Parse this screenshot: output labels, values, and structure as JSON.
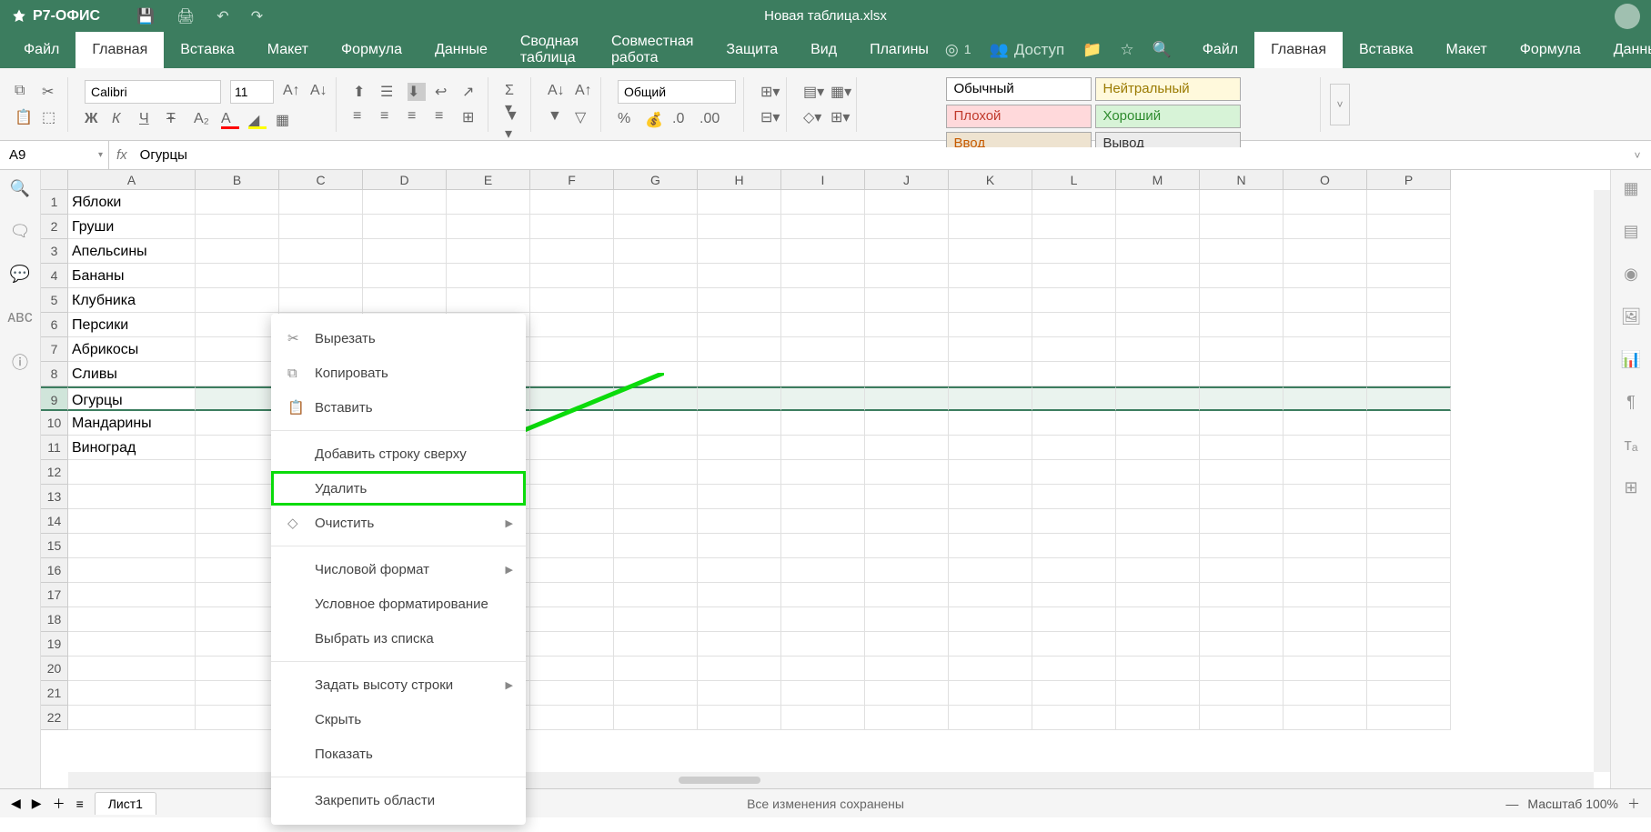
{
  "app_name": "Р7-ОФИС",
  "document_title": "Новая таблица.xlsx",
  "menu_tabs": [
    "Файл",
    "Главная",
    "Вставка",
    "Макет",
    "Формула",
    "Данные",
    "Сводная таблица",
    "Совместная работа",
    "Защита",
    "Вид",
    "Плагины"
  ],
  "active_tab_index": 1,
  "access_label": "Доступ",
  "badge_count": "1",
  "toolbar": {
    "font_name": "Calibri",
    "font_size": "11",
    "number_format": "Общий",
    "styles": [
      {
        "label": "Обычный",
        "bg": "#ffffff",
        "fg": "#000"
      },
      {
        "label": "Нейтральный",
        "bg": "#fff9dc",
        "fg": "#9a7a00"
      },
      {
        "label": "Плохой",
        "bg": "#ffd9db",
        "fg": "#c0392b"
      },
      {
        "label": "Хороший",
        "bg": "#d7f3d7",
        "fg": "#2e8b2e"
      },
      {
        "label": "Ввод",
        "bg": "#eee3d0",
        "fg": "#c65a00"
      },
      {
        "label": "Вывод",
        "bg": "#ececec",
        "fg": "#333"
      }
    ]
  },
  "cell_reference": "A9",
  "formula_value": "Огурцы",
  "columns": [
    "A",
    "B",
    "C",
    "D",
    "E",
    "F",
    "G",
    "H",
    "I",
    "J",
    "K",
    "L",
    "M",
    "N",
    "O",
    "P"
  ],
  "row_count": 22,
  "selected_row": 9,
  "data_column_A": [
    "Яблоки",
    "Груши",
    "Апельсины",
    "Бананы",
    "Клубника",
    "Персики",
    "Абрикосы",
    "Сливы",
    "Огурцы",
    "Мандарины",
    "Виноград"
  ],
  "context_menu": {
    "items": [
      {
        "icon": "✂",
        "label": "Вырезать"
      },
      {
        "icon": "⧉",
        "label": "Копировать"
      },
      {
        "icon": "📋",
        "label": "Вставить"
      },
      {
        "sep": true
      },
      {
        "label": "Добавить строку сверху"
      },
      {
        "label": "Удалить",
        "highlight": true
      },
      {
        "icon": "◇",
        "label": "Очистить",
        "arrow": true
      },
      {
        "sep": true
      },
      {
        "label": "Числовой формат",
        "arrow": true
      },
      {
        "label": "Условное форматирование"
      },
      {
        "label": "Выбрать из списка"
      },
      {
        "sep": true
      },
      {
        "label": "Задать высоту строки",
        "arrow": true
      },
      {
        "label": "Скрыть"
      },
      {
        "label": "Показать"
      },
      {
        "sep": true
      },
      {
        "label": "Закрепить области"
      }
    ]
  },
  "sheet_name": "Лист1",
  "status_message": "Все изменения сохранены",
  "zoom_label": "Масштаб 100%"
}
